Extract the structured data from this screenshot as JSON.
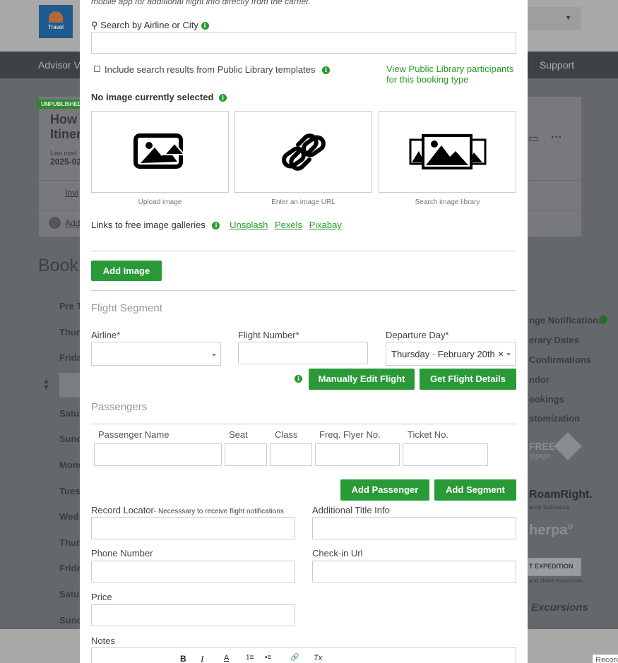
{
  "background": {
    "logo_text": "Travel",
    "nav_left": "Advisor Vi",
    "nav_right": "Support",
    "badge": "UNPUBLISHED",
    "card_title_1": "How",
    "card_title_2": "Itiner",
    "card_meta": "Last mod",
    "card_date": "2025-02",
    "card_invite": "Invi",
    "card_add": "Add",
    "book_heading": "Book",
    "days": [
      "Pre T",
      "Thur",
      "Frida",
      "Satu",
      "Sund",
      "Mond",
      "Tues",
      "Wed",
      "Thur",
      "Frida",
      "Satu",
      "Sund"
    ],
    "right_links": [
      "nge Notifications",
      "erary Dates",
      "Confirmations",
      "ndor",
      "ookings",
      "stomization"
    ],
    "right_logos": [
      "FREE",
      "ggage",
      "RoamRight.",
      "ance Specialists",
      "herpa°",
      "T EXPEDITION",
      "and shore excursions",
      "Excursions"
    ],
    "record_button": "Record"
  },
  "modal": {
    "intro_text": "mobile app for additional flight info directly from the carrier.",
    "search_label": "Search by Airline or City",
    "search_value": "",
    "include_public_label": "Include search results from Public Library templates",
    "view_participants_link": "View Public Library participants for this booking type",
    "no_image_label": "No image currently selected",
    "image_options": [
      {
        "caption": "Upload image",
        "icon": "upload-image-icon"
      },
      {
        "caption": "Enter an image URL",
        "icon": "link-icon"
      },
      {
        "caption": "Search image library",
        "icon": "image-library-icon"
      }
    ],
    "free_galleries_label": "Links to free image galleries",
    "gallery_links": [
      "Unsplash",
      "Pexels",
      "Pixabay"
    ],
    "add_image_button": "Add Image",
    "flight_segment_title": "Flight Segment",
    "airline_label": "Airline*",
    "airline_value": "",
    "flight_number_label": "Flight Number*",
    "flight_number_value": "",
    "departure_day_label": "Departure Day*",
    "departure_day_value": "Thursday · February 20th",
    "manually_edit_button": "Manually Edit Flight",
    "get_flight_button": "Get Flight Details",
    "passengers_title": "Passengers",
    "passenger_columns": [
      "Passenger Name",
      "Seat",
      "Class",
      "Freq. Flyer No.",
      "Ticket No."
    ],
    "add_passenger_button": "Add Passenger",
    "add_segment_button": "Add Segment",
    "record_locator_label": "Record Locator",
    "record_locator_hint": "- Necesssary to receive flight notifications",
    "additional_title_label": "Additional Title Info",
    "phone_label": "Phone Number",
    "checkin_label": "Check-in Url",
    "price_label": "Price",
    "notes_label": "Notes",
    "toolbar": [
      "B",
      "I",
      "A",
      "1≡",
      "•≡",
      "🔗",
      "Tx"
    ]
  },
  "colors": {
    "accent_green": "#2a9a38",
    "overlay": "#5d6166"
  }
}
